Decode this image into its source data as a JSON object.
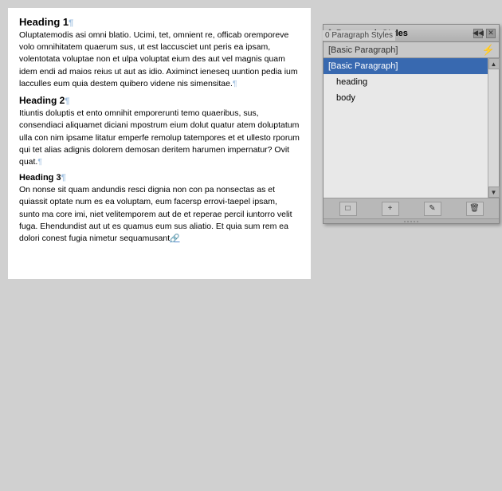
{
  "document": {
    "heading1": "Heading 1",
    "body1": "Oluptatemodis asi omni blatio. Ucimi, tet, omnient re, officab oremporeve volo omnihitatem quaerum sus, ut est laccusciet unt peris ea ipsam, volentotata voluptae non et ulpa voluptat eium des aut vel magnis quam idem endi ad maios reius ut aut as idio. Aximinct ieneseq uuntion pedia ium lacculles eum quia destem quibero videne nis simensitae.",
    "heading2": "Heading 2",
    "body2": "Itiuntis doluptis et ento omnihit emporerunti temo quaeribus, sus, consendiaci aliquamet diciani mpostrum eium dolut quatur atem doluptatum ulla con nim ipsame litatur emperfe remolup tatempores et et ullesto rporum qui tet alias adignis dolorem demosan deritem harumen impernatur? Ovit quat.",
    "heading3": "Heading 3",
    "body3": "On nonse sit quam andundis resci dignia non con pa nonsectas as et quiassit optate num es ea voluptam, eum facersp errovi-taepel ipsam, sunto ma core imi, niet velitemporem aut de et reperae percil iuntorro velit fuga. Ehendundist aut ut es quamus eum sus aliatio. Et quia sum rem ea dolori conest fugia nimetur sequamusant"
  },
  "panel": {
    "title": "Paragraph Styles",
    "subheader": "[Basic Paragraph]",
    "count_label": "0 Paragraph Styles",
    "items": [
      {
        "label": "[Basic Paragraph]",
        "selected": true,
        "indented": false
      },
      {
        "label": "heading",
        "selected": false,
        "indented": true
      },
      {
        "label": "body",
        "selected": false,
        "indented": true
      }
    ],
    "footer_buttons": [
      {
        "icon": "page",
        "label": "new-style-group-button"
      },
      {
        "icon": "plus",
        "label": "new-style-button"
      },
      {
        "icon": "arrow",
        "label": "edit-style-button"
      },
      {
        "icon": "trash",
        "label": "delete-style-button"
      }
    ]
  }
}
